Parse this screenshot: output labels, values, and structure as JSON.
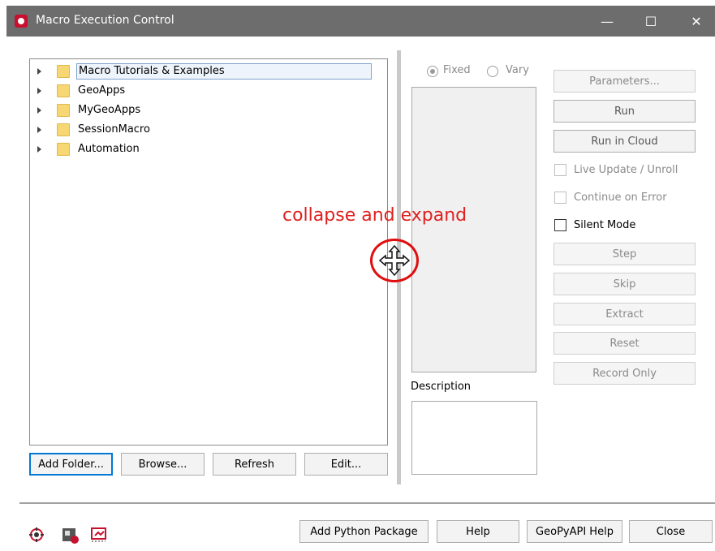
{
  "window": {
    "title": "Macro Execution Control",
    "controls": {
      "minimize": "—",
      "maximize": "☐",
      "close": "✕"
    }
  },
  "tree": {
    "items": [
      {
        "label": "Macro Tutorials & Examples",
        "selected": true
      },
      {
        "label": "GeoApps"
      },
      {
        "label": "MyGeoApps"
      },
      {
        "label": "SessionMacro"
      },
      {
        "label": "Automation"
      }
    ]
  },
  "tree_buttons": {
    "add_folder": "Add Folder...",
    "browse": "Browse...",
    "refresh": "Refresh",
    "edit": "Edit..."
  },
  "mode": {
    "fixed": "Fixed",
    "vary": "Vary",
    "selected": "Fixed"
  },
  "description_label": "Description",
  "actions": {
    "parameters": "Parameters...",
    "run": "Run",
    "run_in_cloud": "Run in Cloud",
    "step": "Step",
    "skip": "Skip",
    "extract": "Extract",
    "reset": "Reset",
    "record_only": "Record Only"
  },
  "options": {
    "live_update": "Live Update / Unroll",
    "continue_on_error": "Continue on Error",
    "silent_mode": "Silent Mode"
  },
  "annotation": {
    "text": "collapse and expand"
  },
  "footer_buttons": {
    "add_python_package": "Add Python Package",
    "help": "Help",
    "geopyapi_help": "GeoPyAPI Help",
    "close": "Close"
  },
  "footer_icons": [
    "settings-gear-icon",
    "macro-record-icon",
    "screen-capture-icon"
  ],
  "colors": {
    "titlebar": "#6d6d6d",
    "annotation": "#e02020",
    "app_icon": "#c8102e"
  }
}
